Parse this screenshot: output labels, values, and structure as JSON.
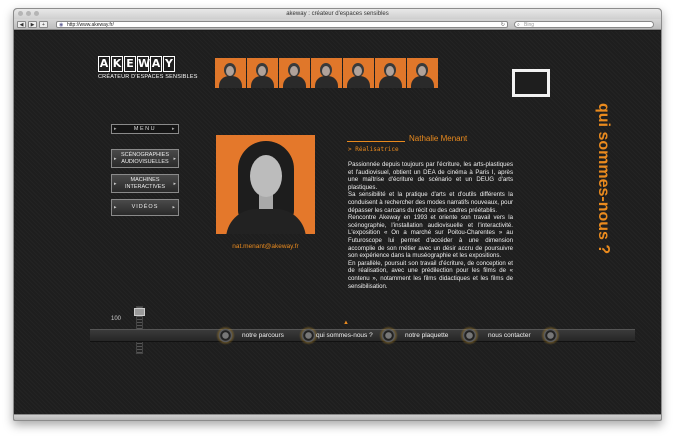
{
  "browser": {
    "window_title": "akeway : créateur d'espaces sensibles",
    "url": "http://www.akeway.fr/",
    "search_placeholder": "Bing",
    "back_label": "◀",
    "forward_label": "▶",
    "add_label": "+"
  },
  "logo": {
    "letters": [
      "A",
      "K",
      "E",
      "W",
      "A",
      "Y"
    ],
    "tagline": "CRÉATEUR D'ESPACES SENSIBLES"
  },
  "team": {
    "photo_count": 7
  },
  "side_title": "qui sommes-nous ?",
  "menu": {
    "header": "MENU",
    "items": [
      {
        "label": "SCÉNOGRAPHIES AUDIOVISUELLES"
      },
      {
        "label": "MACHINES INTERACTIVES"
      },
      {
        "label": "VIDÉOS"
      }
    ]
  },
  "profile": {
    "name": "Nathalie Menant",
    "role": "> Réalisatrice",
    "email": "nat.menant@akeway.fr",
    "bio": [
      "Passionnée depuis toujours par l'écriture, les arts-plastiques et l'audiovisuel, obtient un DEA de cinéma à Paris I, après une maîtrise d'écriture de scénario et un DEUG d'arts plastiques.",
      "Sa sensibilité et la pratique d'arts et d'outils différents la conduisent à rechercher des modes narratifs nouveaux, pour dépasser les carcans du récit ou des cadres préétablis.",
      "Rencontre Akeway en 1993 et oriente son travail vers la scénographie, l'installation audiovisuelle et l'interactivité. L'exposition « On a marché sur Poitou-Charentes » au Futuroscope lui permet d'accéder à une dimension accomplie de son métier avec un désir accru de poursuivre son expérience dans la muséographie et les expositions.",
      "En parallèle, poursuit son travail d'écriture, de conception et de réalisation, avec une prédilection pour les films de « contenu », notamment les films didactiques et les films de sensibilisation."
    ]
  },
  "volume": {
    "label": "100",
    "level_percent": 100
  },
  "bottom_nav": {
    "items": [
      {
        "label": "notre parcours"
      },
      {
        "label": "qui sommes-nous ?"
      },
      {
        "label": "notre plaquette"
      },
      {
        "label": "nous contacter"
      }
    ],
    "active_index": 1
  },
  "colors": {
    "accent": "#e98a1e",
    "background": "#1e1e1e",
    "text": "#f0f0f0"
  }
}
